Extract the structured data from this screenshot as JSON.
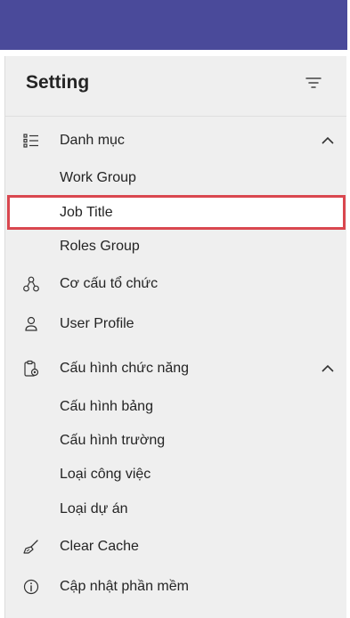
{
  "panel": {
    "title": "Setting"
  },
  "menu": {
    "danh_muc": {
      "label": "Danh mục",
      "icon": "list-icon",
      "expanded": true
    },
    "danh_muc_items": [
      {
        "label": "Work Group"
      },
      {
        "label": "Job Title",
        "selected": true
      },
      {
        "label": "Roles Group"
      }
    ],
    "co_cau": {
      "label": "Cơ cấu tổ chức",
      "icon": "org-structure-icon"
    },
    "user_profile": {
      "label": "User Profile",
      "icon": "person-icon"
    },
    "cau_hinh": {
      "label": "Cấu hình chức năng",
      "icon": "clipboard-gear-icon",
      "expanded": true
    },
    "cau_hinh_items": [
      {
        "label": "Cấu hình bảng"
      },
      {
        "label": "Cấu hình trường"
      },
      {
        "label": "Loại công việc"
      },
      {
        "label": "Loại dự án"
      }
    ],
    "clear_cache": {
      "label": "Clear Cache",
      "icon": "broom-icon"
    },
    "update": {
      "label": "Cập nhật phần mềm",
      "icon": "info-icon"
    }
  },
  "colors": {
    "topbar": "#4a4a9a",
    "panel_bg": "#efefef",
    "highlight_border": "#d9474f"
  }
}
